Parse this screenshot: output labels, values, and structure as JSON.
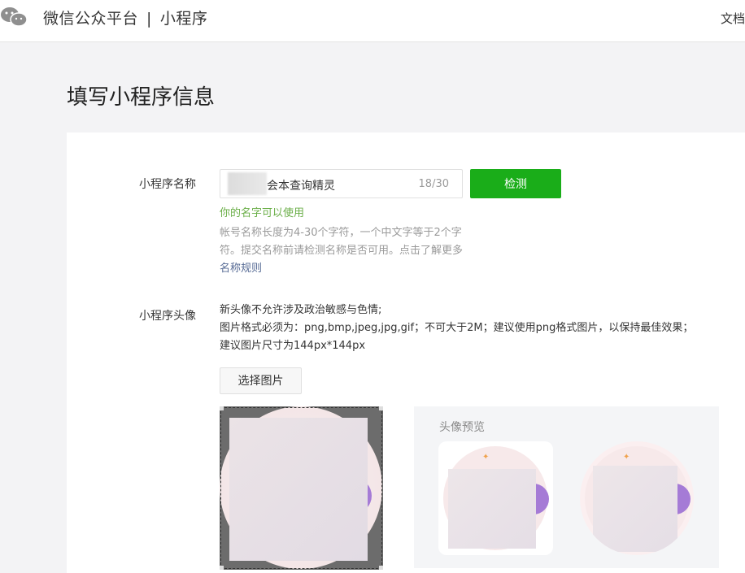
{
  "header": {
    "brand": "微信公众平台",
    "separator": "|",
    "section": "小程序",
    "docs": "文档"
  },
  "page": {
    "title": "填写小程序信息"
  },
  "name_field": {
    "label": "小程序名称",
    "value": "会本查询精灵",
    "counter": "18/30",
    "check_button": "检测",
    "success_message": "你的名字可以使用",
    "hint": "帐号名称长度为4-30个字符，一个中文字等于2个字符。提交名称前请检测名称是否可用。点击了解更多",
    "hint_link": "名称规则"
  },
  "avatar": {
    "label": "小程序头像",
    "notes": [
      "新头像不允许涉及政治敏感与色情;",
      "图片格式必须为：png,bmp,jpeg,jpg,gif；不可大于2M；建议使用png格式图片，以保持最佳效果；",
      "建议图片尺寸为144px*144px"
    ],
    "select_button": "选择图片",
    "preview_title": "头像预览"
  },
  "colors": {
    "primary": "#1aad19",
    "success_text": "#6aae47",
    "link": "#576b95",
    "avatar_accent": "#a57bd6"
  },
  "icons": {
    "logo": "wechat-logo-icon"
  }
}
